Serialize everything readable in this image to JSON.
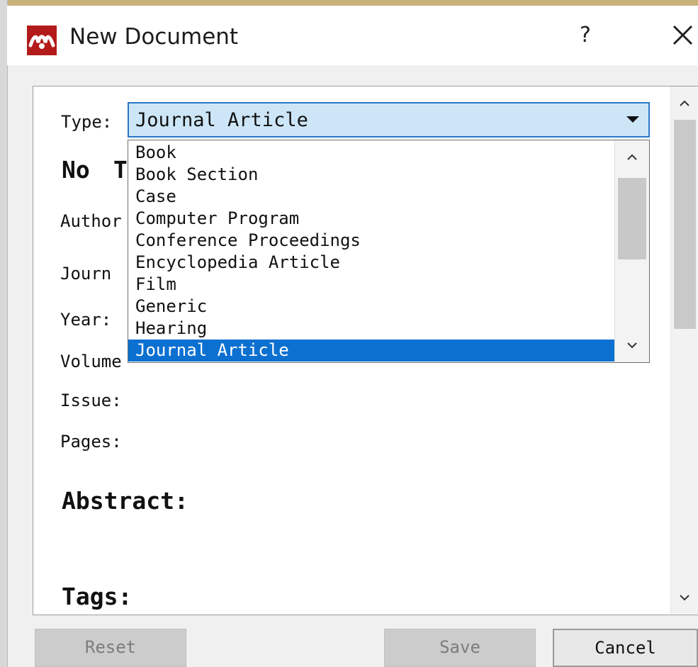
{
  "window": {
    "title": "New Document",
    "help_label": "?",
    "icons": {
      "app": "mendeley-logo-icon",
      "close": "close-icon"
    }
  },
  "form": {
    "type_label": "Type:",
    "type_value": "Journal Article",
    "title_preview": "No",
    "title_fragment": "T",
    "fields": [
      "Author",
      "Journ",
      "Year:",
      "Volume",
      "Issue:",
      "Pages:"
    ],
    "abstract_label": "Abstract:",
    "tags_label": "Tags:"
  },
  "dropdown": {
    "items": [
      "Book",
      "Book Section",
      "Case",
      "Computer Program",
      "Conference Proceedings",
      "Encyclopedia Article",
      "Film",
      "Generic",
      "Hearing",
      "Journal Article"
    ],
    "selected": "Journal Article"
  },
  "buttons": {
    "reset": "Reset",
    "save": "Save",
    "cancel": "Cancel"
  },
  "colors": {
    "selection": "#0c70d1",
    "select_bg": "#cde6f7",
    "select_border": "#2b78c7",
    "icon_red": "#b31b1b"
  }
}
